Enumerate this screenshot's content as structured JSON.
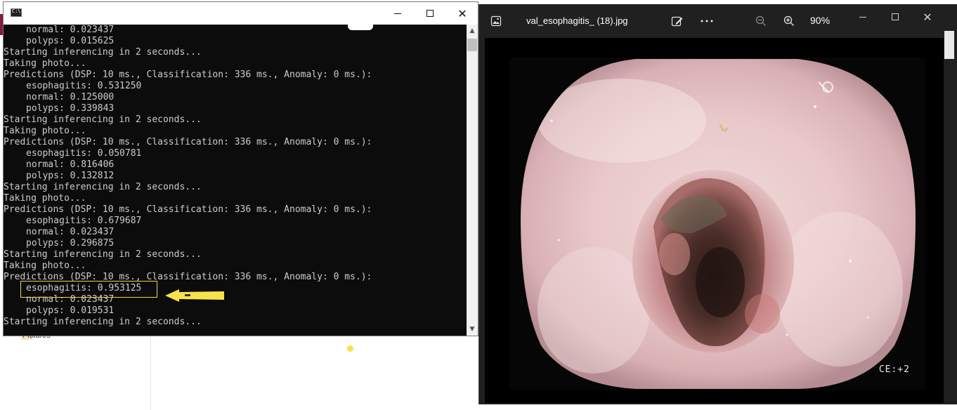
{
  "console": {
    "lines": [
      {
        "text": "normal: 0.023437",
        "indent": true
      },
      {
        "text": "polyps: 0.015625",
        "indent": true
      },
      {
        "text": "Starting inferencing in 2 seconds...",
        "indent": false
      },
      {
        "text": "Taking photo...",
        "indent": false
      },
      {
        "text": "Predictions (DSP: 10 ms., Classification: 336 ms., Anomaly: 0 ms.):",
        "indent": false
      },
      {
        "text": "esophagitis: 0.531250",
        "indent": true
      },
      {
        "text": "normal: 0.125000",
        "indent": true
      },
      {
        "text": "polyps: 0.339843",
        "indent": true
      },
      {
        "text": "Starting inferencing in 2 seconds...",
        "indent": false
      },
      {
        "text": "Taking photo...",
        "indent": false
      },
      {
        "text": "Predictions (DSP: 10 ms., Classification: 336 ms., Anomaly: 0 ms.):",
        "indent": false
      },
      {
        "text": "esophagitis: 0.050781",
        "indent": true
      },
      {
        "text": "normal: 0.816406",
        "indent": true
      },
      {
        "text": "polyps: 0.132812",
        "indent": true
      },
      {
        "text": "Starting inferencing in 2 seconds...",
        "indent": false
      },
      {
        "text": "Taking photo...",
        "indent": false
      },
      {
        "text": "Predictions (DSP: 10 ms., Classification: 336 ms., Anomaly: 0 ms.):",
        "indent": false
      },
      {
        "text": "esophagitis: 0.679687",
        "indent": true
      },
      {
        "text": "normal: 0.023437",
        "indent": true
      },
      {
        "text": "polyps: 0.296875",
        "indent": true
      },
      {
        "text": "Starting inferencing in 2 seconds...",
        "indent": false
      },
      {
        "text": "Taking photo...",
        "indent": false
      },
      {
        "text": "Predictions (DSP: 10 ms., Classification: 336 ms., Anomaly: 0 ms.):",
        "indent": false
      },
      {
        "text": "esophagitis: 0.953125",
        "indent": true
      },
      {
        "text": "normal: 0.023437",
        "indent": true
      },
      {
        "text": "polyps: 0.019531",
        "indent": true
      },
      {
        "text": "Starting inferencing in 2 seconds...",
        "indent": false
      }
    ],
    "highlight_color": "#f2d34a"
  },
  "photos": {
    "filename": "val_esophagitis_ (18).jpg",
    "zoom": "90%",
    "overlay_text": "CE:+2"
  },
  "background": {
    "folder_label": "Pictures"
  },
  "icons": {
    "console_app": "console-icon",
    "photos_app": "image-icon",
    "edit": "edit-image-icon",
    "more": "more-options-icon",
    "zoom_out": "zoom-out-icon",
    "zoom_in": "zoom-in-icon"
  }
}
